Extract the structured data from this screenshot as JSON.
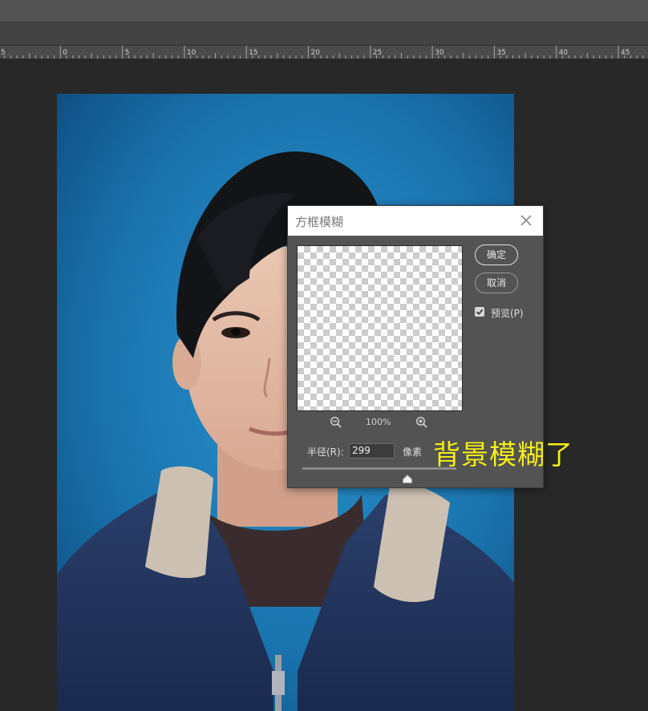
{
  "ruler": {
    "labels": [
      "5",
      "0",
      "5",
      "10",
      "15",
      "20",
      "25",
      "30",
      "35",
      "40",
      "45"
    ]
  },
  "dialog": {
    "title": "方框模糊",
    "ok_label": "确定",
    "cancel_label": "取消",
    "preview_label": "预览(P)",
    "preview_checked": true,
    "zoom_level": "100%",
    "radius_label": "半径(R):",
    "radius_value": "299",
    "radius_unit": "像素",
    "slider_position_fraction": 0.68
  },
  "overlay": {
    "caption": "背景模糊了"
  },
  "colors": {
    "accent_caption": "#f7f019",
    "photo_background": "#1a73ad",
    "dialog_background": "#535353"
  }
}
